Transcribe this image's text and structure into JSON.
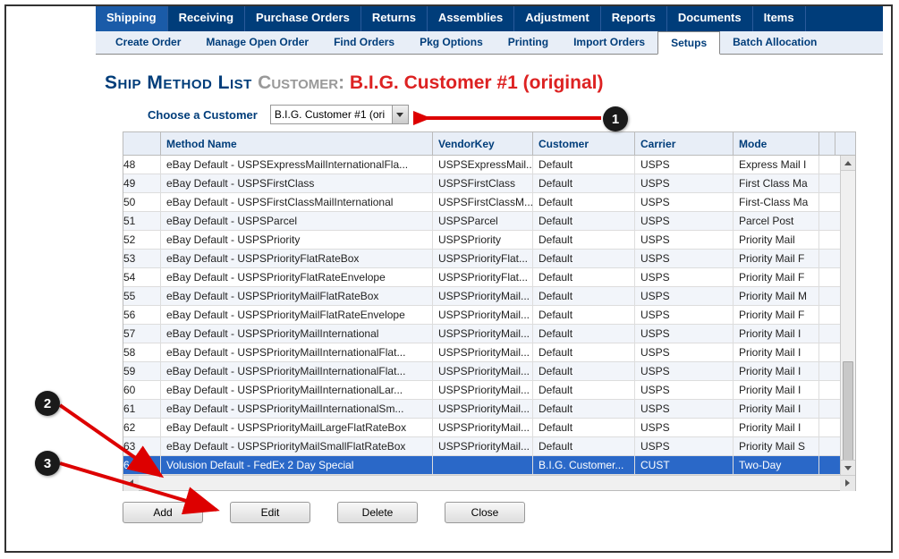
{
  "main_tabs": [
    "Shipping",
    "Receiving",
    "Purchase Orders",
    "Returns",
    "Assemblies",
    "Adjustment",
    "Reports",
    "Documents",
    "Items"
  ],
  "main_tab_active": 0,
  "sub_tabs": [
    "Create Order",
    "Manage Open Order",
    "Find Orders",
    "Pkg Options",
    "Printing",
    "Import Orders",
    "Setups",
    "Batch Allocation"
  ],
  "sub_tab_active": 6,
  "title": {
    "t1": "Ship Method List ",
    "t2": "Customer: ",
    "t3": "B.I.G. Customer #1 (original)"
  },
  "chooser": {
    "label": "Choose a Customer",
    "value": "B.I.G. Customer #1 (ori"
  },
  "columns": {
    "num": "",
    "name": "Method Name",
    "vk": "VendorKey",
    "cust": "Customer",
    "car": "Carrier",
    "mode": "Mode"
  },
  "rows": [
    {
      "num": "48",
      "name": "eBay Default - USPSExpressMailInternationalFla...",
      "vk": "USPSExpressMail...",
      "cust": "Default",
      "car": "USPS",
      "mode": "Express Mail I"
    },
    {
      "num": "49",
      "name": "eBay Default - USPSFirstClass",
      "vk": "USPSFirstClass",
      "cust": "Default",
      "car": "USPS",
      "mode": "First Class Ma"
    },
    {
      "num": "50",
      "name": "eBay Default - USPSFirstClassMailInternational",
      "vk": "USPSFirstClassM...",
      "cust": "Default",
      "car": "USPS",
      "mode": "First-Class Ma"
    },
    {
      "num": "51",
      "name": "eBay Default - USPSParcel",
      "vk": "USPSParcel",
      "cust": "Default",
      "car": "USPS",
      "mode": "Parcel Post"
    },
    {
      "num": "52",
      "name": "eBay Default - USPSPriority",
      "vk": "USPSPriority",
      "cust": "Default",
      "car": "USPS",
      "mode": "Priority Mail"
    },
    {
      "num": "53",
      "name": "eBay Default - USPSPriorityFlatRateBox",
      "vk": "USPSPriorityFlat...",
      "cust": "Default",
      "car": "USPS",
      "mode": "Priority Mail F"
    },
    {
      "num": "54",
      "name": "eBay Default - USPSPriorityFlatRateEnvelope",
      "vk": "USPSPriorityFlat...",
      "cust": "Default",
      "car": "USPS",
      "mode": "Priority Mail F"
    },
    {
      "num": "55",
      "name": "eBay Default - USPSPriorityMailFlatRateBox",
      "vk": "USPSPriorityMail...",
      "cust": "Default",
      "car": "USPS",
      "mode": "Priority Mail M"
    },
    {
      "num": "56",
      "name": "eBay Default - USPSPriorityMailFlatRateEnvelope",
      "vk": "USPSPriorityMail...",
      "cust": "Default",
      "car": "USPS",
      "mode": "Priority Mail F"
    },
    {
      "num": "57",
      "name": "eBay Default - USPSPriorityMailInternational",
      "vk": "USPSPriorityMail...",
      "cust": "Default",
      "car": "USPS",
      "mode": "Priority Mail I"
    },
    {
      "num": "58",
      "name": "eBay Default - USPSPriorityMailInternationalFlat...",
      "vk": "USPSPriorityMail...",
      "cust": "Default",
      "car": "USPS",
      "mode": "Priority Mail I"
    },
    {
      "num": "59",
      "name": "eBay Default - USPSPriorityMailInternationalFlat...",
      "vk": "USPSPriorityMail...",
      "cust": "Default",
      "car": "USPS",
      "mode": "Priority Mail I"
    },
    {
      "num": "60",
      "name": "eBay Default - USPSPriorityMailInternationalLar...",
      "vk": "USPSPriorityMail...",
      "cust": "Default",
      "car": "USPS",
      "mode": "Priority Mail I"
    },
    {
      "num": "61",
      "name": "eBay Default - USPSPriorityMailInternationalSm...",
      "vk": "USPSPriorityMail...",
      "cust": "Default",
      "car": "USPS",
      "mode": "Priority Mail I"
    },
    {
      "num": "62",
      "name": "eBay Default - USPSPriorityMailLargeFlatRateBox",
      "vk": "USPSPriorityMail...",
      "cust": "Default",
      "car": "USPS",
      "mode": "Priority Mail I"
    },
    {
      "num": "63",
      "name": "eBay Default - USPSPriorityMailSmallFlatRateBox",
      "vk": "USPSPriorityMail...",
      "cust": "Default",
      "car": "USPS",
      "mode": "Priority Mail S"
    },
    {
      "num": "64",
      "name": "Volusion Default - FedEx 2 Day Special",
      "vk": "",
      "cust": "B.I.G. Customer...",
      "car": "CUST",
      "mode": "Two-Day",
      "selected": true
    }
  ],
  "buttons": {
    "add": "Add",
    "edit": "Edit",
    "delete": "Delete",
    "close": "Close"
  },
  "callouts": {
    "c1": "1",
    "c2": "2",
    "c3": "3"
  }
}
